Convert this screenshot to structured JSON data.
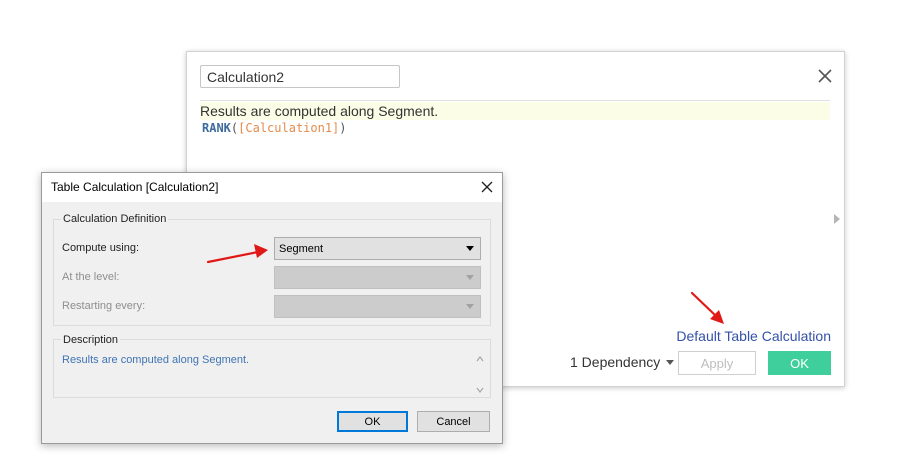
{
  "calc_editor": {
    "name_value": "Calculation2",
    "status_text": "Results are computed along Segment.",
    "formula": {
      "function": "RANK",
      "open": "(",
      "field": "[Calculation1]",
      "close": ")"
    },
    "default_table_calc_link": "Default Table Calculation",
    "dependency_label": "1 Dependency",
    "apply_label": "Apply",
    "ok_label": "OK"
  },
  "table_calc_dialog": {
    "title": "Table Calculation [Calculation2]",
    "definition_group_title": "Calculation Definition",
    "compute_using_label": "Compute using:",
    "compute_using_value": "Segment",
    "at_level_label": "At the level:",
    "restarting_label": "Restarting every:",
    "description_group_title": "Description",
    "description_text": "Results are computed along Segment.",
    "ok_label": "OK",
    "cancel_label": "Cancel"
  },
  "colors": {
    "accent_green": "#3ecf9c",
    "link_blue": "#3551a9",
    "annotation_red": "#e01818",
    "description_blue": "#3f74b3"
  }
}
